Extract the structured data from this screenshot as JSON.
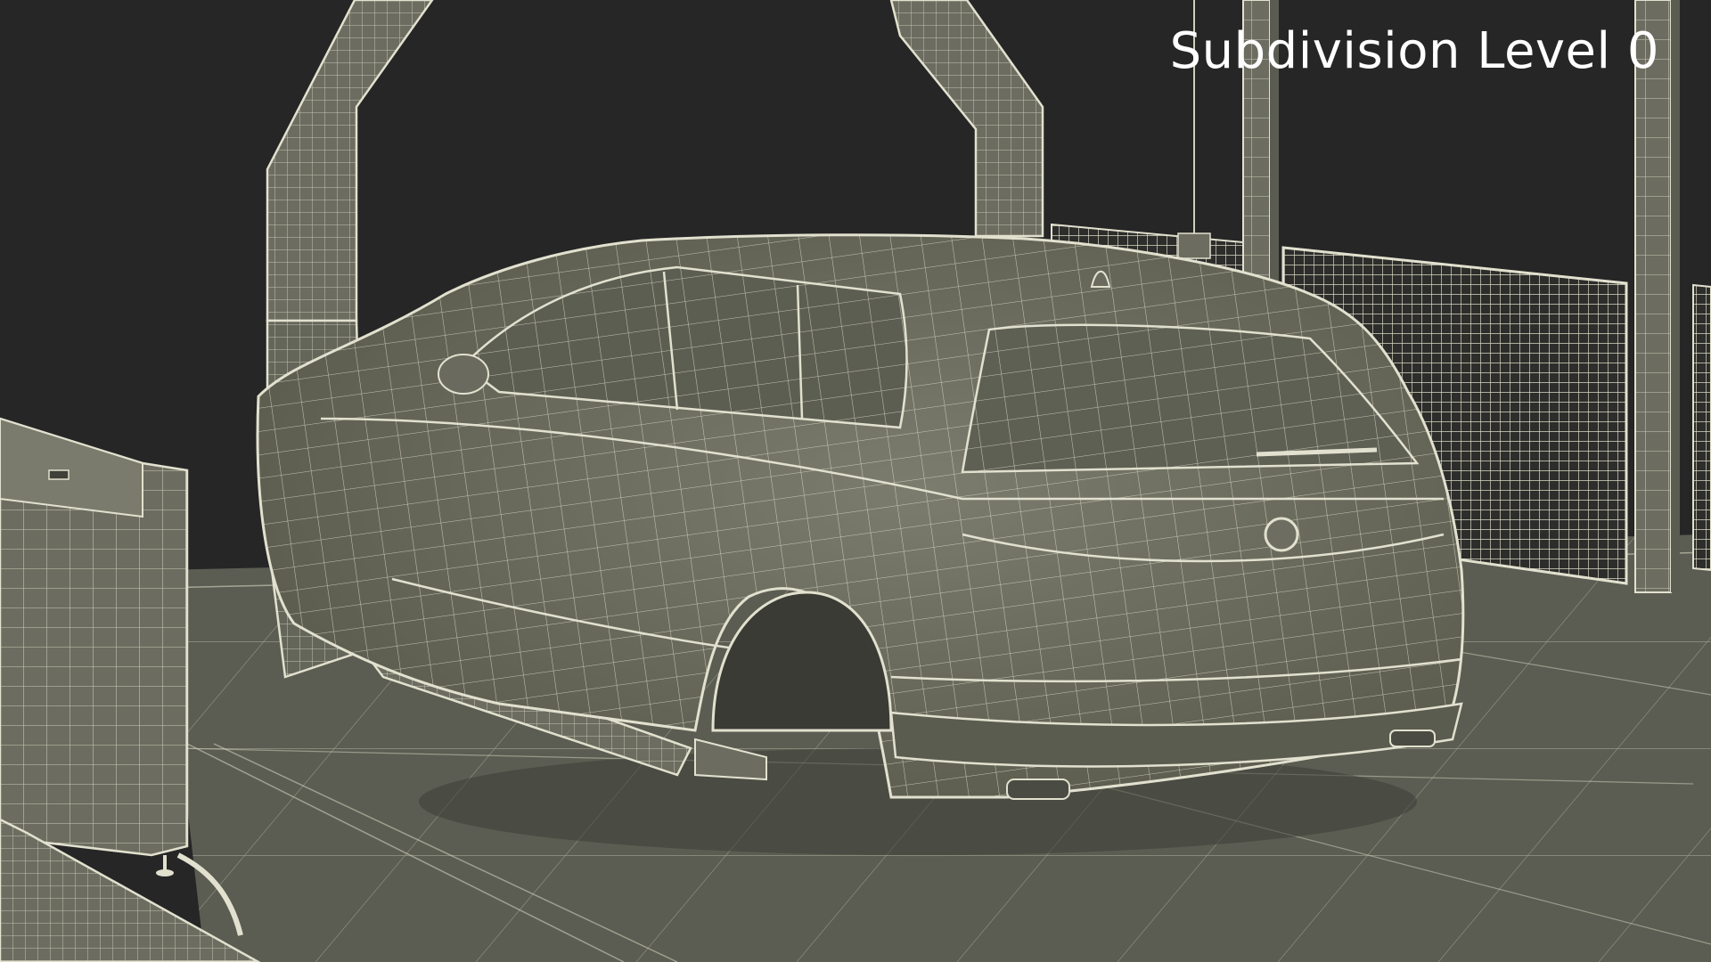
{
  "overlay": {
    "label": "Subdivision Level 0"
  },
  "colors": {
    "background": "#262626",
    "mesh_fill": "#6f6f62",
    "mesh_fill_dark": "#55574c",
    "wire": "#e2e1cf",
    "floor": "#5c5d52"
  },
  "scene": {
    "subject": "car-body-wireframe",
    "gantry": "overhead-hanger-arm",
    "fence": "mesh-safety-fence",
    "console": "control-cabinet"
  }
}
